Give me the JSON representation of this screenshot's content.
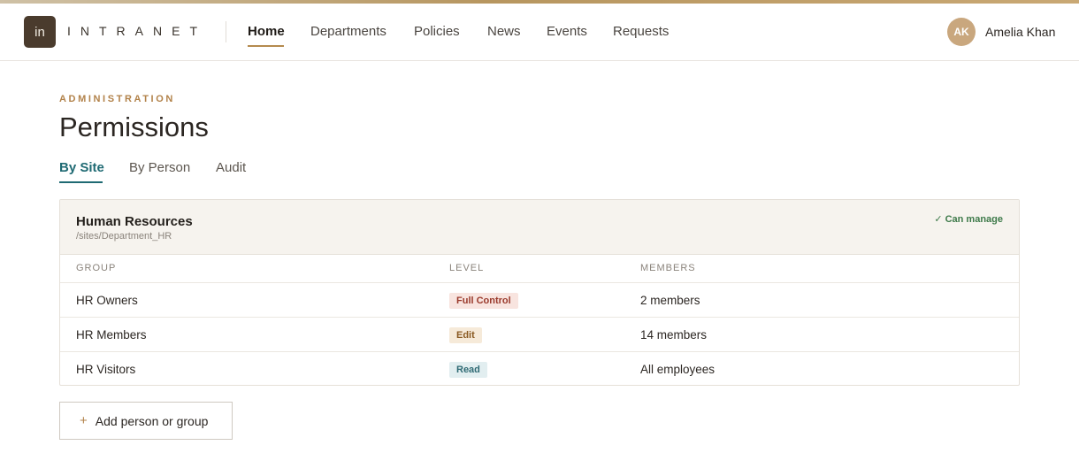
{
  "brand": {
    "logo_text": "in",
    "name": "INTRANET"
  },
  "nav": [
    {
      "label": "Home",
      "active": true
    },
    {
      "label": "Departments"
    },
    {
      "label": "Policies"
    },
    {
      "label": "News"
    },
    {
      "label": "Events"
    },
    {
      "label": "Requests"
    }
  ],
  "user": {
    "initials": "AK",
    "name": "Amelia Khan"
  },
  "page": {
    "eyebrow": "ADMINISTRATION",
    "title": "Permissions"
  },
  "tabs": [
    {
      "label": "By Site",
      "active": true
    },
    {
      "label": "By Person"
    },
    {
      "label": "Audit"
    }
  ],
  "site": {
    "name": "Human Resources",
    "path": "/sites/Department_HR",
    "status": "✓ Can manage"
  },
  "table": {
    "headers": [
      "GROUP",
      "LEVEL",
      "MEMBERS"
    ],
    "rows": [
      {
        "group": "HR Owners",
        "level": "Full Control",
        "members": "2 members"
      },
      {
        "group": "HR Members",
        "level": "Edit",
        "members": "14 members"
      },
      {
        "group": "HR Visitors",
        "level": "Read",
        "members": "All employees"
      }
    ]
  },
  "actions": {
    "add_icon": "+",
    "add_label": "Add person or group"
  },
  "colors": {
    "accent_gold": "#b2824a",
    "accent_teal": "#1f6a73",
    "logo_bg": "#4a3b2d",
    "success": "#3e7a4a"
  }
}
